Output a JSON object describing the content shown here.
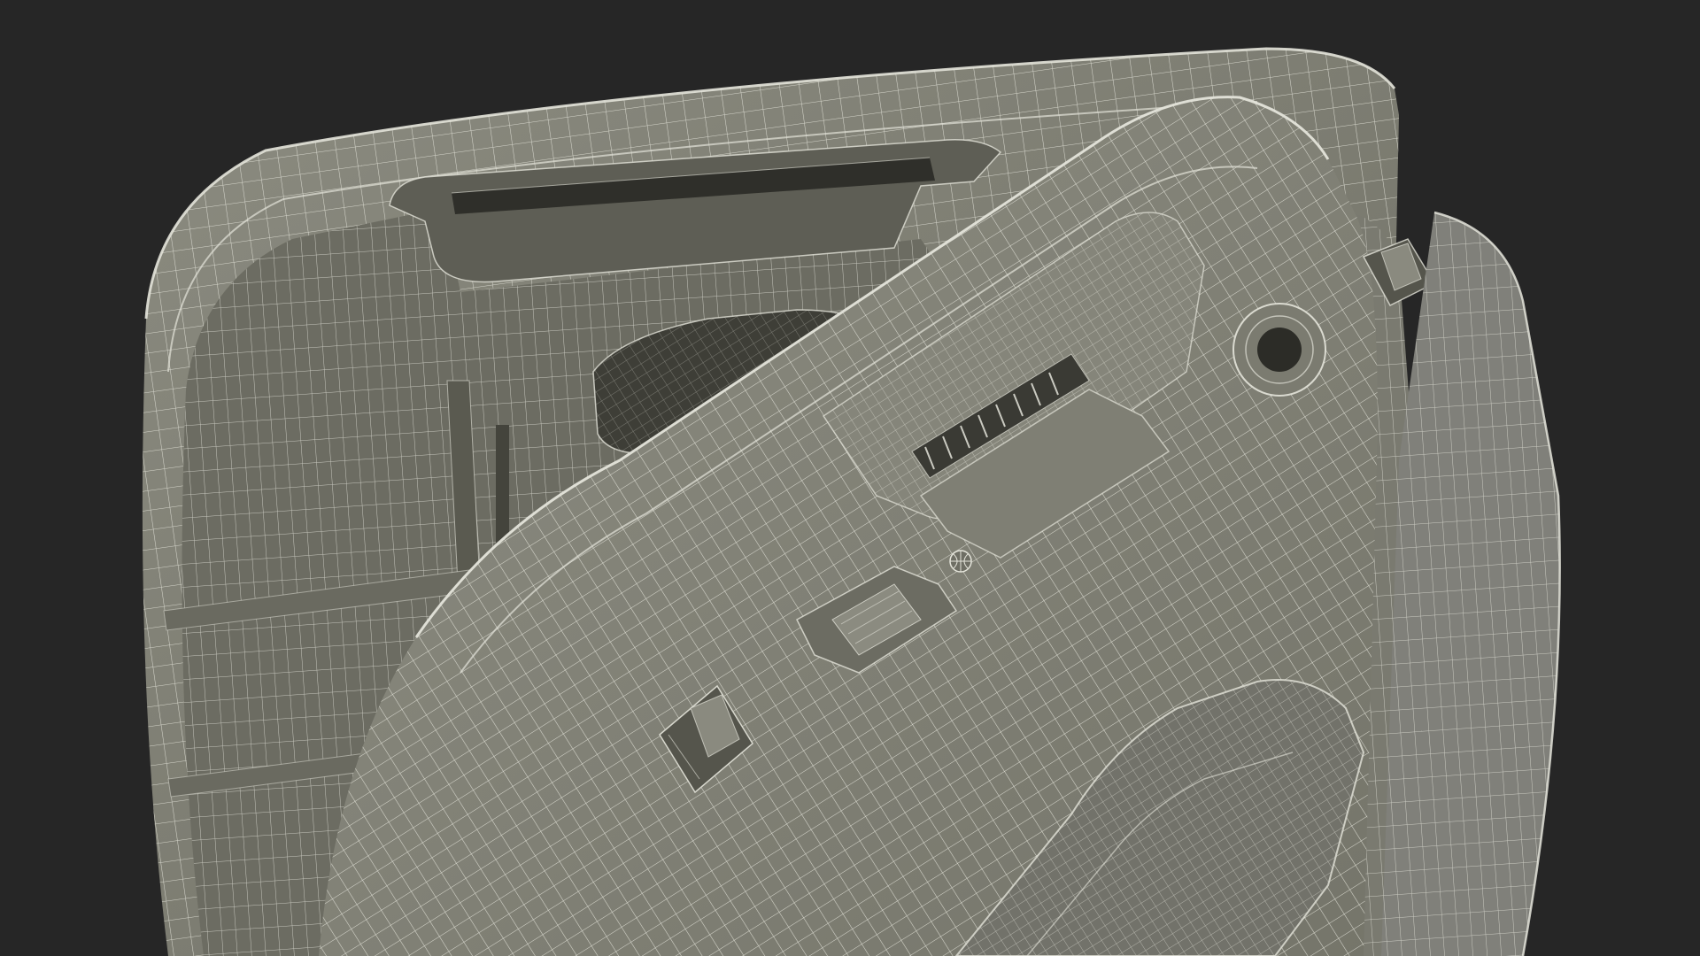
{
  "scene": {
    "subject": "wireframe-render-of-handheld-device-with-open-lid",
    "colors": {
      "background": "#262626",
      "surface": "#7b7b70",
      "surface_light": "#8b8b80",
      "surface_dark": "#5a5a50",
      "recess": "#3a3a34",
      "wire": "#e4e4da"
    }
  }
}
